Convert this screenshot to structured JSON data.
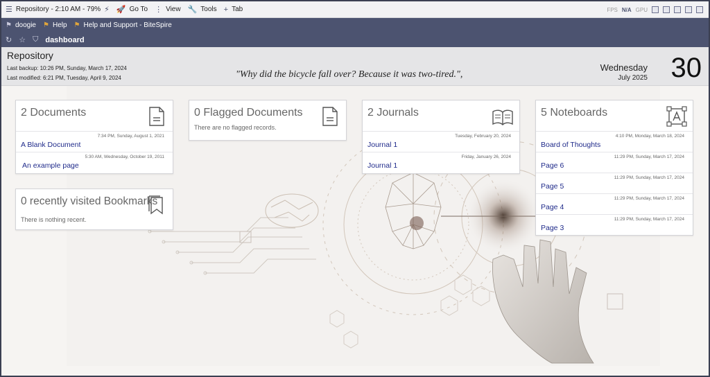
{
  "topbar": {
    "status": "Repository - 2:10 AM - 79%",
    "goto": "Go To",
    "view": "View",
    "tools": "Tools",
    "tab": "Tab",
    "fps_label": "FPS",
    "fps_value": "N/A",
    "gpu_label": "GPU"
  },
  "nav": {
    "links": [
      "doogie",
      "Help",
      "Help and Support - BiteSpire"
    ],
    "active_tab": "dashboard"
  },
  "header": {
    "title": "Repository",
    "last_backup": "Last backup: 10:26 PM, Sunday, March 17, 2024",
    "last_modified": "Last modified: 6:21 PM, Tuesday, April 9, 2024",
    "quote": "\"Why did the bicycle fall over? Because it was two-tired.\",",
    "weekday": "Wednesday",
    "month_year": "July 2025",
    "day": "30"
  },
  "cards": {
    "documents": {
      "title": "2 Documents",
      "rows": [
        {
          "ts": "7:34 PM, Sunday, August 1, 2021",
          "label": "A Blank Document"
        },
        {
          "ts": "5:30 AM, Wednesday, October 19, 2011",
          "label": "An example page"
        }
      ]
    },
    "flagged": {
      "title": "0 Flagged Documents",
      "empty": "There are no flagged records."
    },
    "journals": {
      "title": "2 Journals",
      "rows": [
        {
          "ts": "Tuesday, February 20, 2024",
          "label": "Journal 1"
        },
        {
          "ts": "Friday, January 26, 2024",
          "label": "Journal 1"
        }
      ]
    },
    "noteboards": {
      "title": "5 Noteboards",
      "rows": [
        {
          "ts": "4:10 PM, Monday, March 18, 2024",
          "label": "Board of Thoughts"
        },
        {
          "ts": "11:29 PM, Sunday, March 17, 2024",
          "label": "Page 6"
        },
        {
          "ts": "11:29 PM, Sunday, March 17, 2024",
          "label": "Page 5"
        },
        {
          "ts": "11:29 PM, Sunday, March 17, 2024",
          "label": "Page 4"
        },
        {
          "ts": "11:29 PM, Sunday, March 17, 2024",
          "label": "Page 3"
        }
      ]
    },
    "bookmarks": {
      "title": "0 recently visited Bookmarks",
      "empty": "There is nothing recent."
    }
  },
  "colors": {
    "navbar": "#4c5370",
    "link": "#1f2a8a",
    "flag": "#e0a53b"
  },
  "icons": {
    "menu": "hamburger-menu-icon",
    "goto": "rocket-icon",
    "view": "dots-vertical-icon",
    "tools": "wrench-icon",
    "tab": "plus-icon",
    "refresh": "refresh-icon",
    "star": "star-icon",
    "shield": "shield-icon",
    "flag": "flag-icon",
    "document": "document-icon",
    "journal": "open-book-icon",
    "noteboard": "noteboard-icon",
    "bookmark": "bookmark-icon"
  }
}
